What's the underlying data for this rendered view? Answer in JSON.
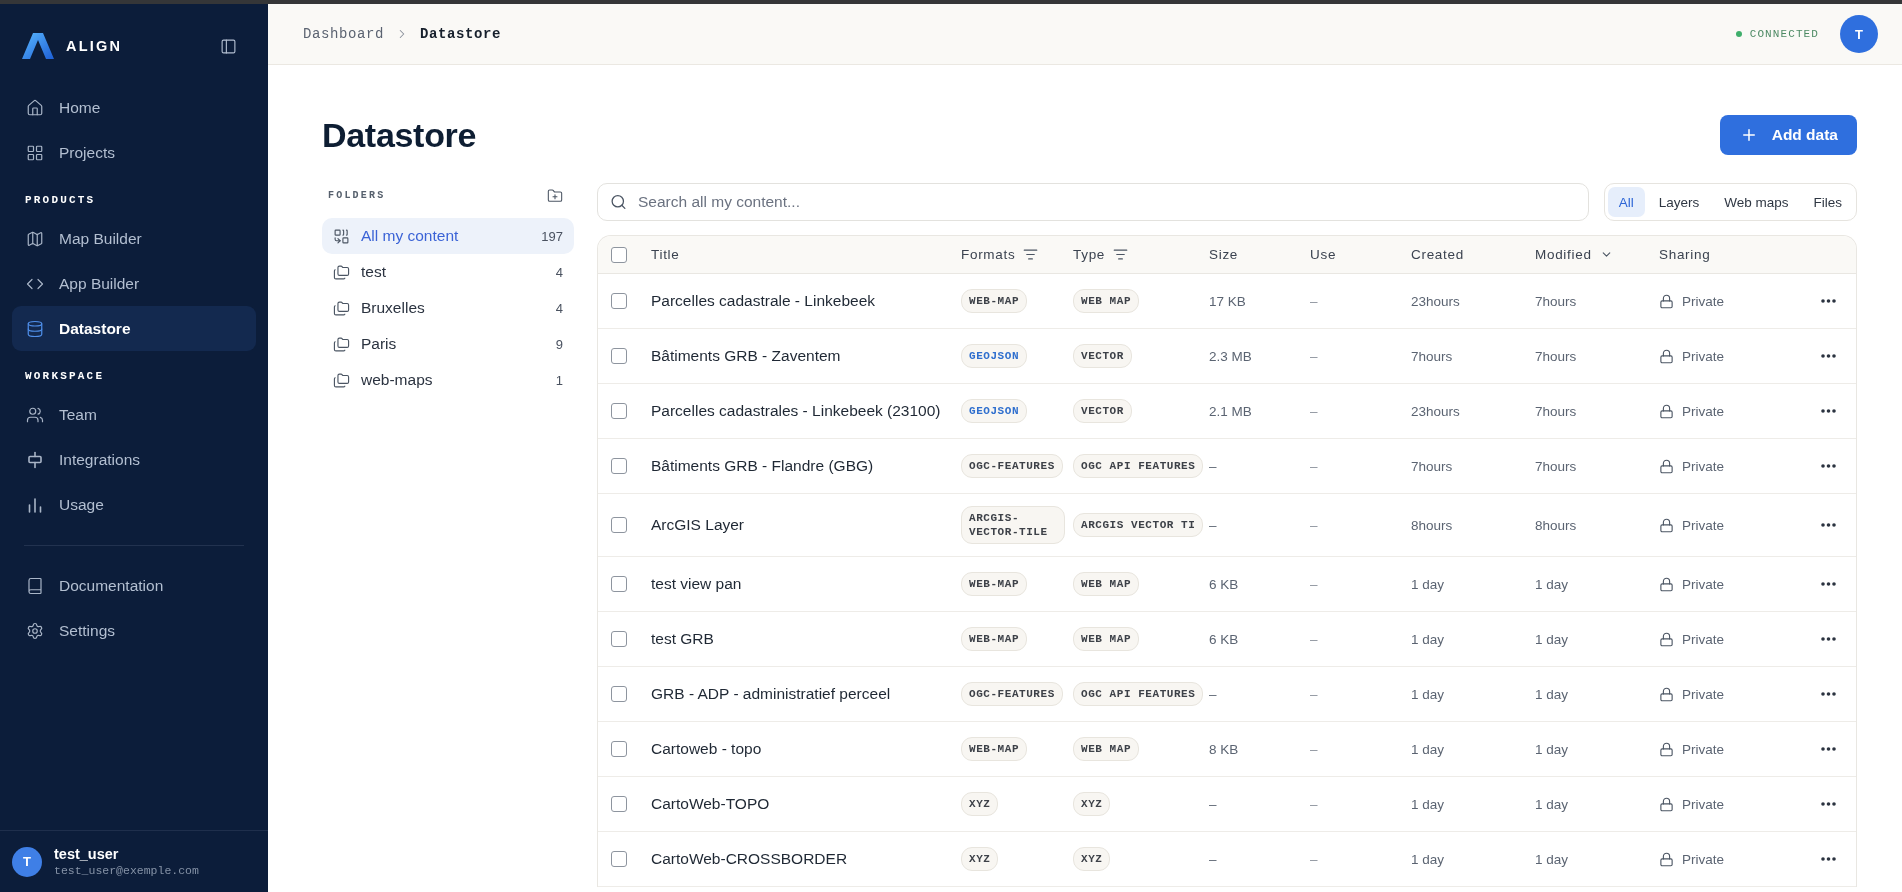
{
  "sidebar": {
    "brand": "ALIGN",
    "nav": [
      {
        "items": [
          {
            "label": "Home",
            "selected": false
          },
          {
            "label": "Projects",
            "selected": false
          }
        ]
      },
      {
        "title": "PRODUCTS",
        "items": [
          {
            "label": "Map Builder",
            "selected": false
          },
          {
            "label": "App Builder",
            "selected": false
          },
          {
            "label": "Datastore",
            "selected": true
          }
        ]
      },
      {
        "title": "WORKSPACE",
        "items": [
          {
            "label": "Team",
            "selected": false
          },
          {
            "label": "Integrations",
            "selected": false
          },
          {
            "label": "Usage",
            "selected": false
          }
        ]
      }
    ],
    "secondary_nav": [
      {
        "label": "Documentation",
        "selected": false
      },
      {
        "label": "Settings",
        "selected": false
      }
    ],
    "user": {
      "initial": "T",
      "name": "test_user",
      "email": "test_user@exemple.com"
    }
  },
  "header": {
    "breadcrumbs": [
      {
        "label": "Dashboard",
        "current": false
      },
      {
        "label": "Datastore",
        "current": true
      }
    ],
    "status": "CONNECTED",
    "avatar": "T"
  },
  "page": {
    "title": "Datastore",
    "add_button": "Add data"
  },
  "folders": {
    "title": "FOLDERS",
    "items": [
      {
        "kind": "all",
        "label": "All my content",
        "count": "197",
        "selected": true
      },
      {
        "kind": "folder",
        "label": "test",
        "count": "4",
        "selected": false
      },
      {
        "kind": "folder",
        "label": "Bruxelles",
        "count": "4",
        "selected": false
      },
      {
        "kind": "folder",
        "label": "Paris",
        "count": "9",
        "selected": false
      },
      {
        "kind": "folder",
        "label": "web-maps",
        "count": "1",
        "selected": false
      }
    ]
  },
  "search": {
    "placeholder": "Search all my content..."
  },
  "filters": [
    {
      "label": "All",
      "selected": true
    },
    {
      "label": "Layers",
      "selected": false
    },
    {
      "label": "Web maps",
      "selected": false
    },
    {
      "label": "Files",
      "selected": false
    }
  ],
  "table": {
    "all_checked": false,
    "columns": [
      {
        "label": "Title",
        "kind": "plain"
      },
      {
        "label": "Formats",
        "kind": "filter"
      },
      {
        "label": "Type",
        "kind": "filter"
      },
      {
        "label": "Size",
        "kind": "plain"
      },
      {
        "label": "Use",
        "kind": "plain"
      },
      {
        "label": "Created",
        "kind": "plain"
      },
      {
        "label": "Modified",
        "kind": "sort"
      },
      {
        "label": "Sharing",
        "kind": "plain"
      }
    ],
    "rows": [
      {
        "checked": false,
        "title": "Parcelles cadastrale - Linkebeek",
        "format": {
          "label": "WEB-MAP",
          "color": "#3d4148"
        },
        "type": "WEB MAP",
        "size": "17 KB",
        "use": "–",
        "created": "23hours",
        "modified": "7hours",
        "sharing": "Private"
      },
      {
        "checked": false,
        "title": "Bâtiments GRB - Zaventem",
        "format": {
          "label": "GEOJSON",
          "color": "#2f6fce"
        },
        "type": "VECTOR",
        "size": "2.3 MB",
        "use": "–",
        "created": "7hours",
        "modified": "7hours",
        "sharing": "Private"
      },
      {
        "checked": false,
        "title": "Parcelles cadastrales - Linkebeek (23100)",
        "format": {
          "label": "GEOJSON",
          "color": "#2f6fce"
        },
        "type": "VECTOR",
        "size": "2.1 MB",
        "use": "–",
        "created": "23hours",
        "modified": "7hours",
        "sharing": "Private"
      },
      {
        "checked": false,
        "title": "Bâtiments GRB - Flandre (GBG)",
        "format": {
          "label": "OGC-FEATURES",
          "color": "#3d4148"
        },
        "type": "OGC API FEATURES",
        "size": "–",
        "use": "–",
        "created": "7hours",
        "modified": "7hours",
        "sharing": "Private"
      },
      {
        "checked": false,
        "title": "ArcGIS Layer",
        "format": {
          "label": "ARCGIS-VECTOR-TILE",
          "color": "#3d4148"
        },
        "type": "ARCGIS VECTOR TI",
        "size": "–",
        "use": "–",
        "created": "8hours",
        "modified": "8hours",
        "sharing": "Private"
      },
      {
        "checked": false,
        "title": "test view pan",
        "format": {
          "label": "WEB-MAP",
          "color": "#3d4148"
        },
        "type": "WEB MAP",
        "size": "6 KB",
        "use": "–",
        "created": "1 day",
        "modified": "1 day",
        "sharing": "Private"
      },
      {
        "checked": false,
        "title": "test GRB",
        "format": {
          "label": "WEB-MAP",
          "color": "#3d4148"
        },
        "type": "WEB MAP",
        "size": "6 KB",
        "use": "–",
        "created": "1 day",
        "modified": "1 day",
        "sharing": "Private"
      },
      {
        "checked": false,
        "title": "GRB - ADP - administratief perceel",
        "format": {
          "label": "OGC-FEATURES",
          "color": "#3d4148"
        },
        "type": "OGC API FEATURES",
        "size": "–",
        "use": "–",
        "created": "1 day",
        "modified": "1 day",
        "sharing": "Private"
      },
      {
        "checked": false,
        "title": "Cartoweb - topo",
        "format": {
          "label": "WEB-MAP",
          "color": "#3d4148"
        },
        "type": "WEB MAP",
        "size": "8 KB",
        "use": "–",
        "created": "1 day",
        "modified": "1 day",
        "sharing": "Private"
      },
      {
        "checked": false,
        "title": "CartoWeb-TOPO",
        "format": {
          "label": "XYZ",
          "color": "#3d4148"
        },
        "type": "XYZ",
        "size": "–",
        "use": "–",
        "created": "1 day",
        "modified": "1 day",
        "sharing": "Private"
      },
      {
        "checked": false,
        "title": "CartoWeb-CROSSBORDER",
        "format": {
          "label": "XYZ",
          "color": "#3d4148"
        },
        "type": "XYZ",
        "size": "–",
        "use": "–",
        "created": "1 day",
        "modified": "1 day",
        "sharing": "Private"
      }
    ]
  }
}
